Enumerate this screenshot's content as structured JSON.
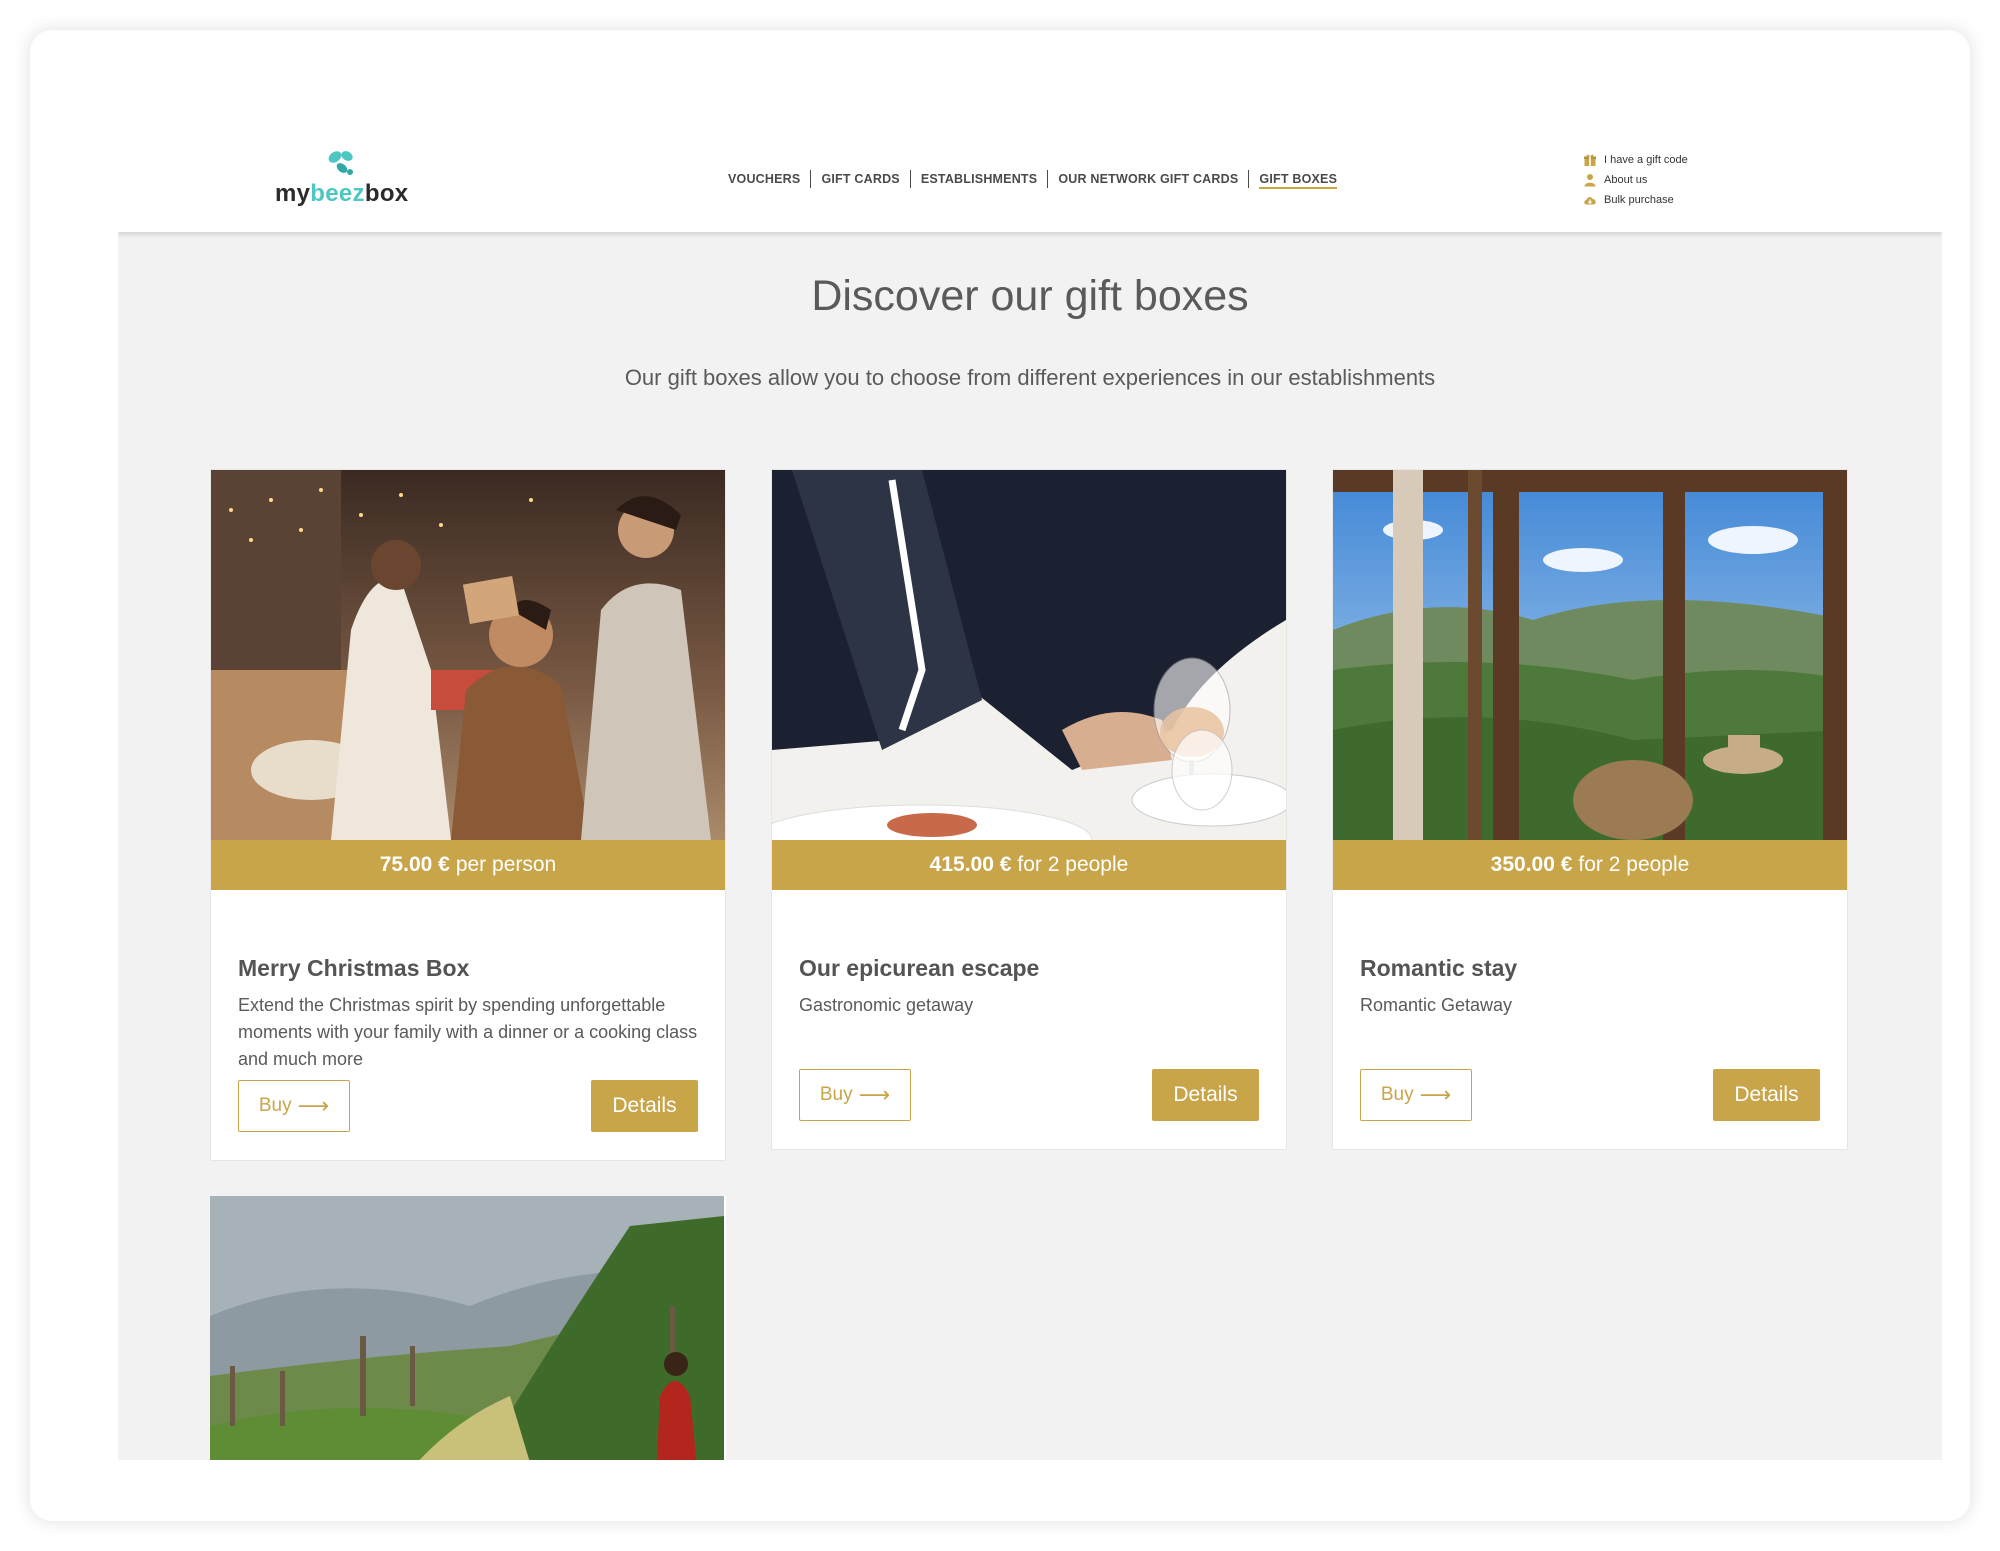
{
  "brand": {
    "logo_left": "my",
    "logo_mid": "beez",
    "logo_right": "box"
  },
  "nav": {
    "items": [
      "VOUCHERS",
      "GIFT CARDS",
      "ESTABLISHMENTS",
      "OUR NETWORK GIFT CARDS",
      "GIFT BOXES"
    ],
    "active": "GIFT BOXES"
  },
  "utility": {
    "items": [
      {
        "label": "I have a gift code",
        "icon": "gift-icon"
      },
      {
        "label": "About us",
        "icon": "user-icon"
      },
      {
        "label": "Bulk purchase",
        "icon": "cloud-icon"
      }
    ]
  },
  "main": {
    "title": "Discover our gift boxes",
    "subtitle": "Our gift boxes allow you to choose from different experiences in our establishments"
  },
  "cards": [
    {
      "price": "75.00 €",
      "price_unit": "per person",
      "title": "Merry Christmas Box",
      "description": "Extend the Christmas spirit by spending unforgettable moments with your family with a dinner or a cooking class and much more",
      "buy_label": "Buy",
      "details_label": "Details",
      "image": "christmas-family-gift"
    },
    {
      "price": "415.00 €",
      "price_unit": "for 2 people",
      "title": "Our epicurean escape",
      "description": "Gastronomic getaway",
      "buy_label": "Buy",
      "details_label": "Details",
      "image": "waiter-serving-wine"
    },
    {
      "price": "350.00 €",
      "price_unit": "for 2 people",
      "title": "Romantic stay",
      "description": "Romantic Getaway",
      "buy_label": "Buy",
      "details_label": "Details",
      "image": "terrace-mountain-view"
    },
    {
      "image": "vineyard-walk"
    }
  ],
  "colors": {
    "accent": "#c9a54a",
    "logo_teal": "#4ec6c2",
    "background": "#f2f2f2",
    "text": "#5a5a5a"
  }
}
